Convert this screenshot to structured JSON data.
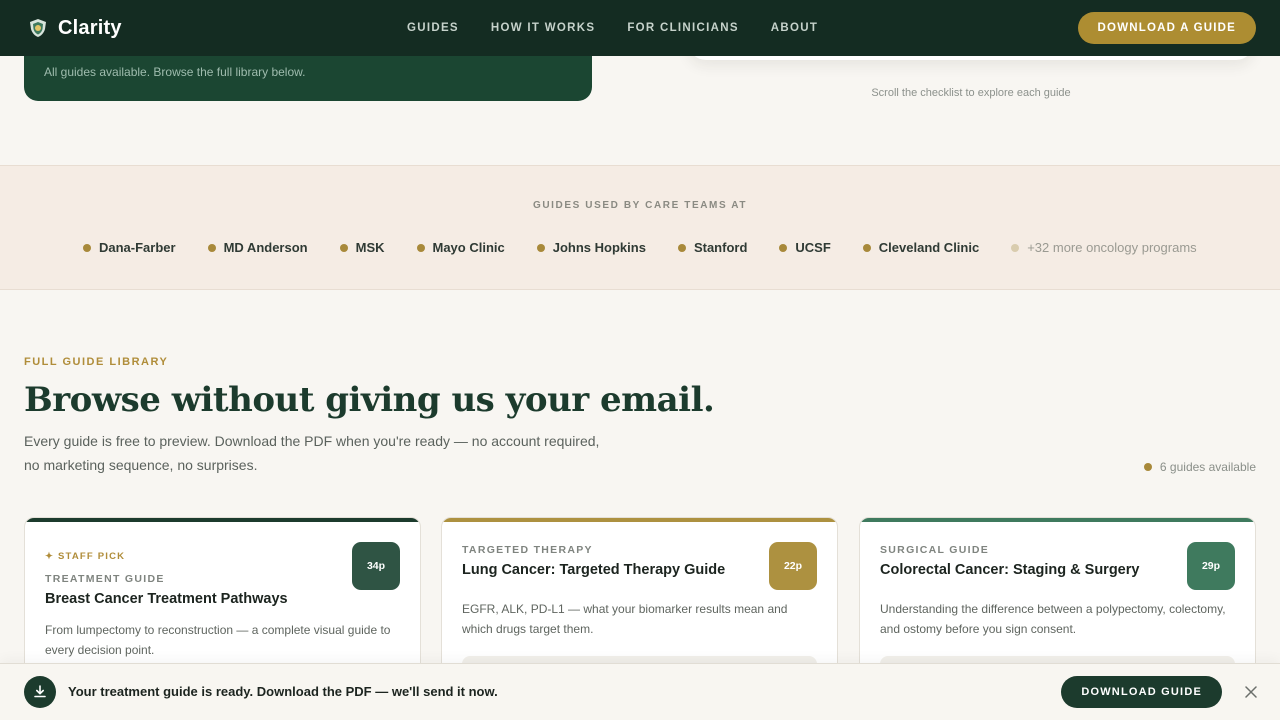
{
  "nav": {
    "brand": "Clarity",
    "links": [
      "GUIDES",
      "HOW IT WORKS",
      "FOR CLINICIANS",
      "ABOUT"
    ],
    "cta": "DOWNLOAD A GUIDE"
  },
  "hero": {
    "card_text": "All guides available. Browse the full library below.",
    "scroll_hint": "Scroll the checklist to explore each guide"
  },
  "strip": {
    "title": "GUIDES USED BY CARE TEAMS AT",
    "orgs": [
      "Dana-Farber",
      "MD Anderson",
      "MSK",
      "Mayo Clinic",
      "Johns Hopkins",
      "Stanford",
      "UCSF",
      "Cleveland Clinic"
    ],
    "more": "+32 more oncology programs"
  },
  "library": {
    "eyebrow": "FULL GUIDE LIBRARY",
    "headline": "Browse without giving us your email.",
    "sub_line1": "Every guide is free to preview. Download the PDF when you're ready — no account required,",
    "sub_line2": "no marketing sequence, no surprises.",
    "available": "6 guides available"
  },
  "cards": [
    {
      "pick": "✦ STAFF PICK",
      "category": "TREATMENT GUIDE",
      "title": "Breast Cancer Treatment Pathways",
      "desc": "From lumpectomy to reconstruction — a complete visual guide to every decision point.",
      "pages": "34p",
      "color": "#2f5444"
    },
    {
      "category": "TARGETED THERAPY",
      "title": "Lung Cancer: Targeted Therapy Guide",
      "desc": "EGFR, ALK, PD-L1 — what your biomarker results mean and which drugs target them.",
      "pages": "22p",
      "color": "#ad9140"
    },
    {
      "category": "SURGICAL GUIDE",
      "title": "Colorectal Cancer: Staging & Surgery",
      "desc": "Understanding the difference between a polypectomy, colectomy, and ostomy before you sign consent.",
      "pages": "29p",
      "color": "#3f7a5e"
    }
  ],
  "banner": {
    "text": "Your treatment guide is ready. Download the PDF — we'll send it now.",
    "button": "DOWNLOAD GUIDE"
  },
  "colors": {
    "nav_bg": "#142c22",
    "accent_gold": "#ad8d32",
    "forest": "#1c3b2d"
  },
  "icons": [
    "clarity-logo-icon",
    "download-icon",
    "close-icon"
  ]
}
